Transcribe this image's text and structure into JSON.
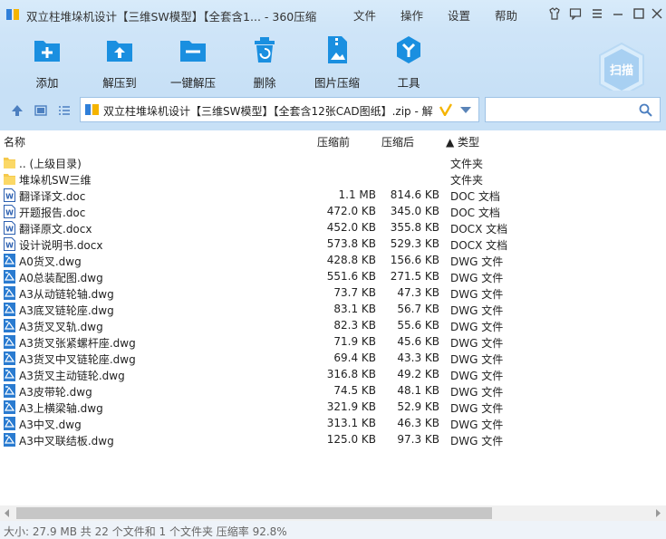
{
  "window": {
    "title": "双立柱堆垛机设计【三维SW模型】【全套含1... - 360压缩",
    "menus": [
      "文件",
      "操作",
      "设置",
      "帮助"
    ]
  },
  "toolbar": {
    "buttons": [
      {
        "label": "添加",
        "icon": "add-file-icon"
      },
      {
        "label": "解压到",
        "icon": "extract-to-icon"
      },
      {
        "label": "一键解压",
        "icon": "one-click-extract-icon"
      },
      {
        "label": "删除",
        "icon": "trash-icon"
      },
      {
        "label": "图片压缩",
        "icon": "image-compress-icon"
      },
      {
        "label": "工具",
        "icon": "tools-icon"
      }
    ],
    "scan_label": "扫描"
  },
  "address": {
    "path": "双立柱堆垛机设计【三维SW模型】【全套含12张CAD图纸】.zip - 解",
    "search_placeholder": ""
  },
  "columns": {
    "name": "名称",
    "size": "压缩前",
    "packed": "压缩后",
    "type": "▲ 类型"
  },
  "files": [
    {
      "icon": "folder-icon",
      "name": ".. (上级目录)",
      "size": "",
      "packed": "",
      "type": "文件夹"
    },
    {
      "icon": "folder-icon",
      "name": "堆垛机SW三维",
      "size": "",
      "packed": "",
      "type": "文件夹"
    },
    {
      "icon": "word-doc-icon",
      "name": "翻译译文.doc",
      "size": "1.1 MB",
      "packed": "814.6 KB",
      "type": "DOC 文档"
    },
    {
      "icon": "word-doc-icon",
      "name": "开题报告.doc",
      "size": "472.0 KB",
      "packed": "345.0 KB",
      "type": "DOC 文档"
    },
    {
      "icon": "word-doc-icon",
      "name": "翻译原文.docx",
      "size": "452.0 KB",
      "packed": "355.8 KB",
      "type": "DOCX 文档"
    },
    {
      "icon": "word-doc-icon",
      "name": "设计说明书.docx",
      "size": "573.8 KB",
      "packed": "529.3 KB",
      "type": "DOCX 文档"
    },
    {
      "icon": "dwg-icon",
      "name": "A0货叉.dwg",
      "size": "428.8 KB",
      "packed": "156.6 KB",
      "type": "DWG 文件"
    },
    {
      "icon": "dwg-icon",
      "name": "A0总装配图.dwg",
      "size": "551.6 KB",
      "packed": "271.5 KB",
      "type": "DWG 文件"
    },
    {
      "icon": "dwg-icon",
      "name": "A3从动链轮轴.dwg",
      "size": "73.7 KB",
      "packed": "47.3 KB",
      "type": "DWG 文件"
    },
    {
      "icon": "dwg-icon",
      "name": "A3底叉链轮座.dwg",
      "size": "83.1 KB",
      "packed": "56.7 KB",
      "type": "DWG 文件"
    },
    {
      "icon": "dwg-icon",
      "name": "A3货叉叉轨.dwg",
      "size": "82.3 KB",
      "packed": "55.6 KB",
      "type": "DWG 文件"
    },
    {
      "icon": "dwg-icon",
      "name": "A3货叉张紧螺杆座.dwg",
      "size": "71.9 KB",
      "packed": "45.6 KB",
      "type": "DWG 文件"
    },
    {
      "icon": "dwg-icon",
      "name": "A3货叉中叉链轮座.dwg",
      "size": "69.4 KB",
      "packed": "43.3 KB",
      "type": "DWG 文件"
    },
    {
      "icon": "dwg-icon",
      "name": "A3货叉主动链轮.dwg",
      "size": "316.8 KB",
      "packed": "49.2 KB",
      "type": "DWG 文件"
    },
    {
      "icon": "dwg-icon",
      "name": "A3皮带轮.dwg",
      "size": "74.5 KB",
      "packed": "48.1 KB",
      "type": "DWG 文件"
    },
    {
      "icon": "dwg-icon",
      "name": "A3上横梁轴.dwg",
      "size": "321.9 KB",
      "packed": "52.9 KB",
      "type": "DWG 文件"
    },
    {
      "icon": "dwg-icon",
      "name": "A3中叉.dwg",
      "size": "313.1 KB",
      "packed": "46.3 KB",
      "type": "DWG 文件"
    },
    {
      "icon": "dwg-icon",
      "name": "A3中叉联结板.dwg",
      "size": "125.0 KB",
      "packed": "97.3 KB",
      "type": "DWG 文件"
    }
  ],
  "status": "大小: 27.9 MB 共 22 个文件和 1 个文件夹 压缩率 92.8%",
  "colors": {
    "accent": "#1a8fe0",
    "toolbar_bg": "#cfe5f8",
    "folder": "#f5c94c"
  }
}
